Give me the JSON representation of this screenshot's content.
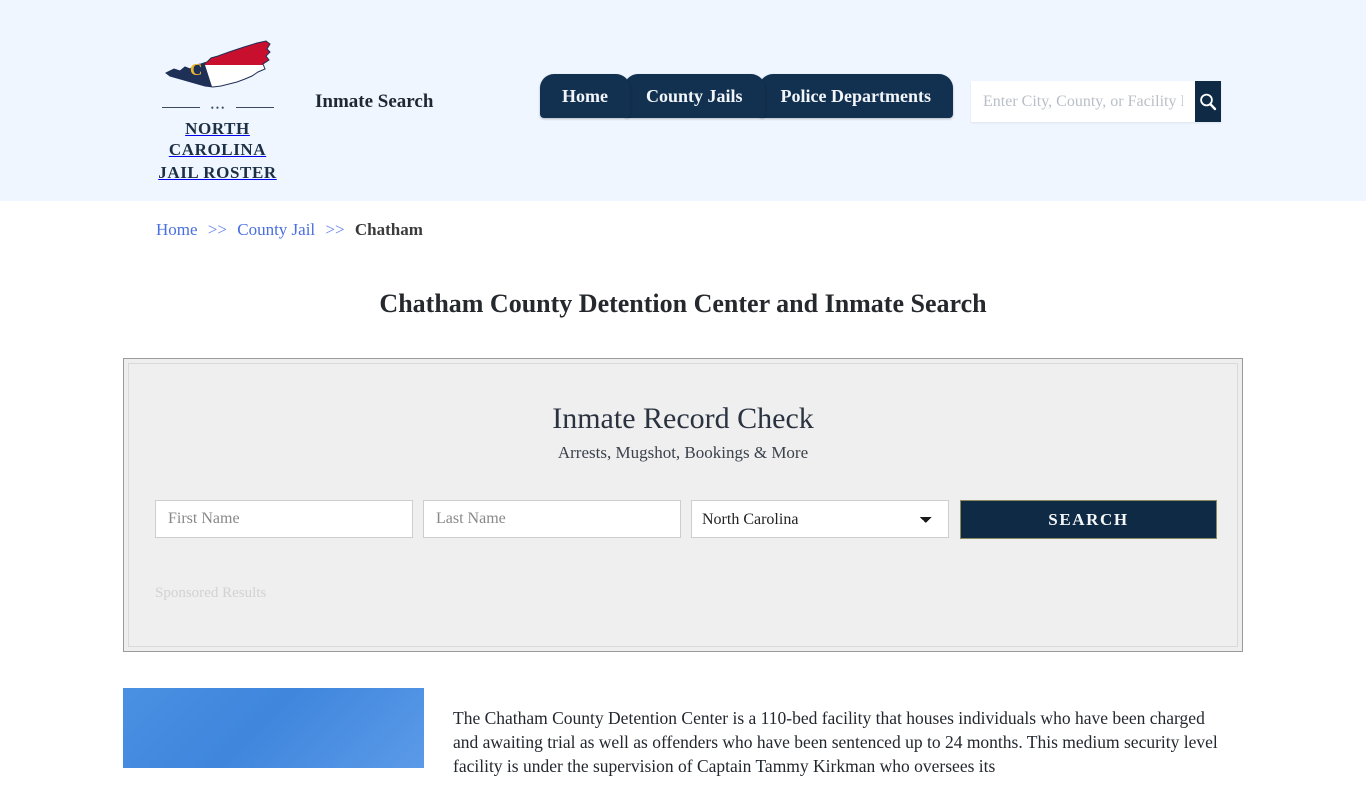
{
  "header": {
    "logo": {
      "state_icon": "north-carolina-state-icon",
      "monogram": "C",
      "name_line1": "NORTH CAROLINA",
      "name_line2": "JAIL ROSTER",
      "dots": "•••"
    },
    "tagline": "Inmate Search",
    "nav": [
      {
        "label": "Home",
        "name": "nav-tab-home"
      },
      {
        "label": "County Jails",
        "name": "nav-tab-county-jails"
      },
      {
        "label": "Police Departments",
        "name": "nav-tab-police-departments"
      }
    ],
    "search": {
      "placeholder": "Enter City, County, or Facility Name",
      "value": "",
      "button_icon": "search-icon"
    },
    "background_color": "#eff6ff",
    "accent_color": "#12304f"
  },
  "breadcrumb": {
    "home": "Home",
    "sep1": ">>",
    "county_jail": "County Jail",
    "sep2": ">>",
    "current": "Chatham"
  },
  "page_title": "Chatham County Detention Center and Inmate Search",
  "record_check": {
    "heading": "Inmate Record Check",
    "subheading": "Arrests, Mugshot, Bookings & More",
    "first_name_placeholder": "First Name",
    "first_name_value": "",
    "last_name_placeholder": "Last Name",
    "last_name_value": "",
    "state_selected": "North Carolina",
    "state_options": [
      "North Carolina"
    ],
    "search_button": "SEARCH",
    "sponsored_label": "Sponsored Results",
    "panel_background": "#eeeeee",
    "button_color": "#0e2a44"
  },
  "article": {
    "image_alt": "detention-center-photo",
    "body": "The Chatham County Detention Center is a 110-bed facility that houses individuals who have been charged and awaiting trial as well as offenders who have been sentenced up to 24 months. This medium security level facility is under the supervision of Captain Tammy Kirkman who oversees its"
  }
}
